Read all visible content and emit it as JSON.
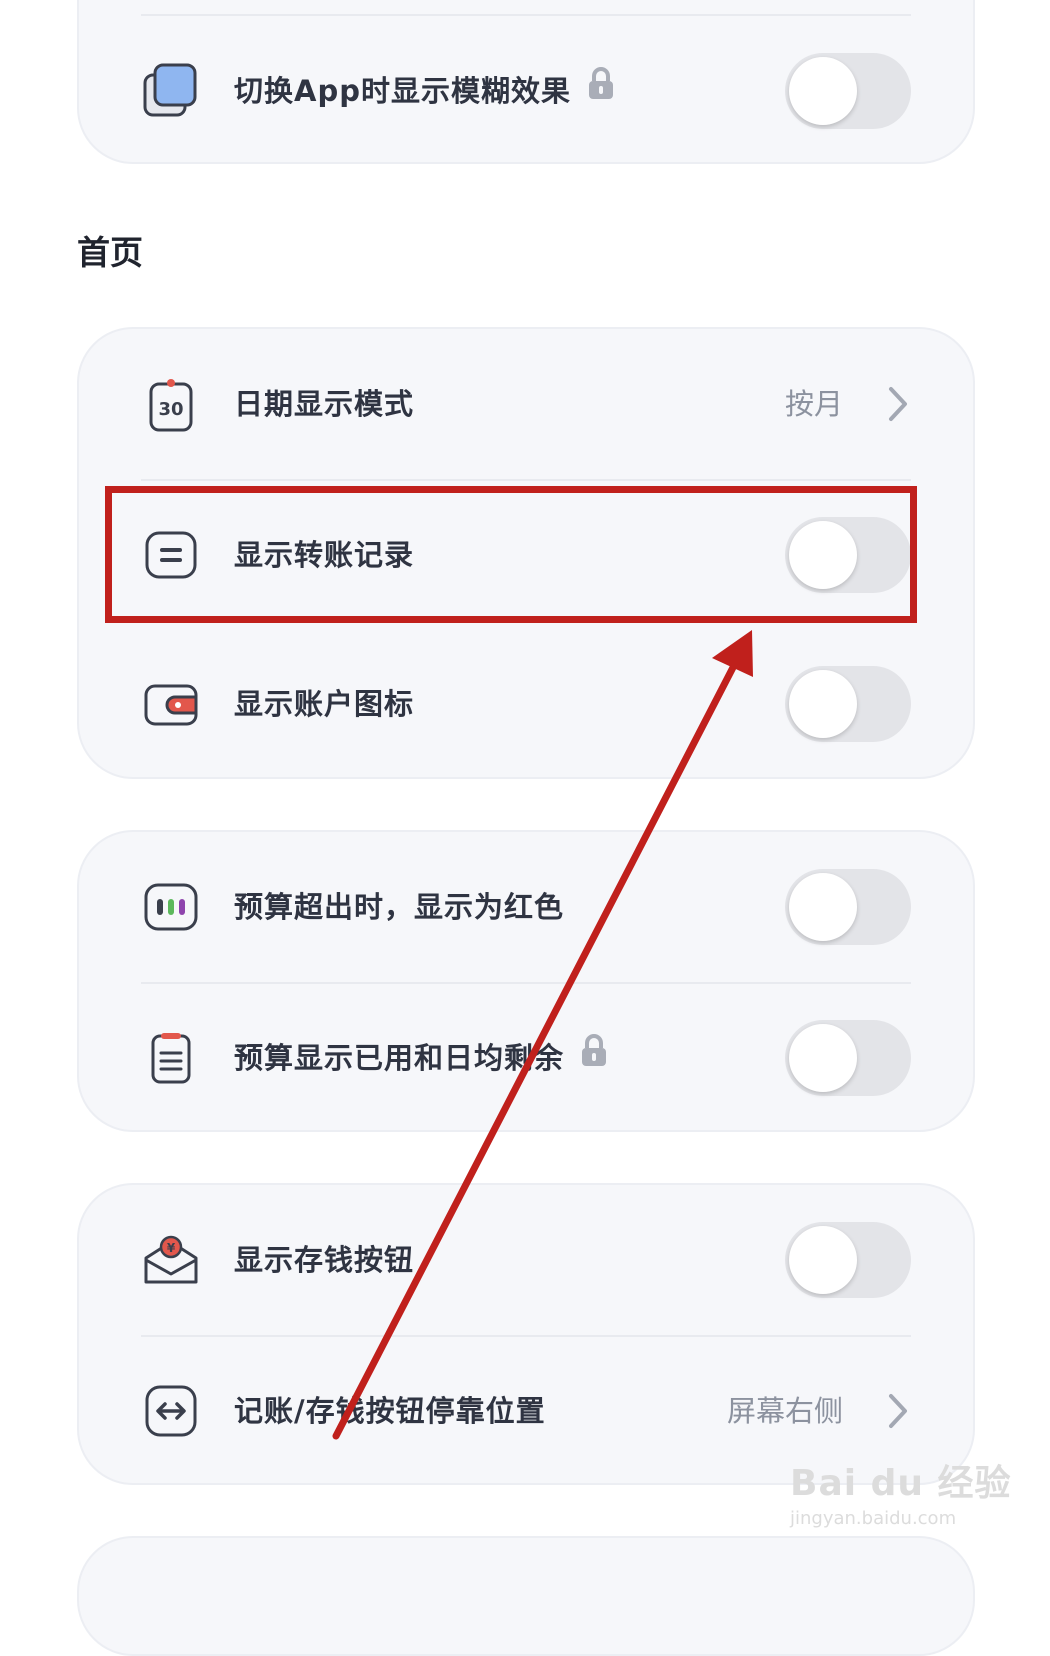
{
  "settings": {
    "top_group": {
      "items": [
        {
          "label": "切换App时显示模糊效果",
          "locked": true,
          "toggle_on": false
        }
      ]
    },
    "home_section": {
      "title": "首页"
    },
    "home_group": {
      "items": [
        {
          "label": "日期显示模式",
          "value": "按月"
        },
        {
          "label": "显示转账记录",
          "toggle_on": false
        },
        {
          "label": "显示账户图标",
          "toggle_on": false
        }
      ]
    },
    "budget_group": {
      "items": [
        {
          "label": "预算超出时，显示为红色",
          "toggle_on": false
        },
        {
          "label": "预算显示已用和日均剩余",
          "locked": true,
          "toggle_on": false
        }
      ]
    },
    "button_group": {
      "items": [
        {
          "label": "显示存钱按钮",
          "toggle_on": false
        },
        {
          "label": "记账/存钱按钮停靠位置",
          "value": "屏幕右侧"
        }
      ]
    }
  },
  "colors": {
    "annotation_red": "#c0201c",
    "card_bg": "#f6f7fa",
    "toggle_off": "#e3e4e8"
  },
  "watermark": {
    "main": "Bai du 经验",
    "sub": "jingyan.baidu.com"
  }
}
